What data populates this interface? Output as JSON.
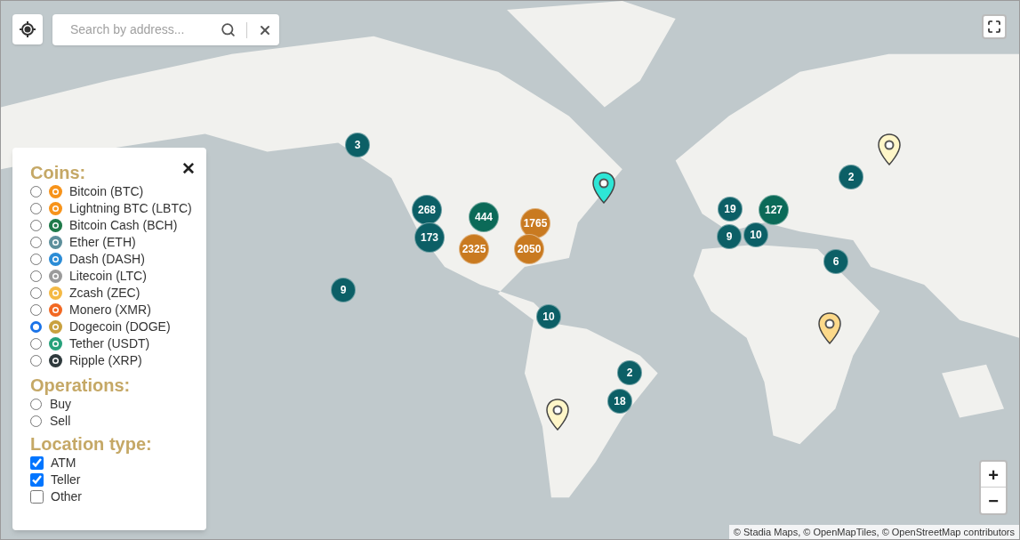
{
  "search": {
    "placeholder": "Search by address..."
  },
  "filters": {
    "close": "✕",
    "coins_title": "Coins:",
    "coins": [
      {
        "label": "Bitcoin (BTC)",
        "selected": false,
        "color": "#f7931a"
      },
      {
        "label": "Lightning BTC (LBTC)",
        "selected": false,
        "color": "#f7931a"
      },
      {
        "label": "Bitcoin Cash (BCH)",
        "selected": false,
        "color": "#1f7a4a"
      },
      {
        "label": "Ether (ETH)",
        "selected": false,
        "color": "#5d8f9b"
      },
      {
        "label": "Dash (DASH)",
        "selected": false,
        "color": "#2b8cd6"
      },
      {
        "label": "Litecoin (LTC)",
        "selected": false,
        "color": "#9b9b9b"
      },
      {
        "label": "Zcash (ZEC)",
        "selected": false,
        "color": "#f4b944"
      },
      {
        "label": "Monero (XMR)",
        "selected": false,
        "color": "#f26822"
      },
      {
        "label": "Dogecoin (DOGE)",
        "selected": true,
        "color": "#c9a13f"
      },
      {
        "label": "Tether (USDT)",
        "selected": false,
        "color": "#26a17b"
      },
      {
        "label": "Ripple (XRP)",
        "selected": false,
        "color": "#2f3a3d"
      }
    ],
    "operations_title": "Operations:",
    "operations": [
      {
        "label": "Buy",
        "selected": false
      },
      {
        "label": "Sell",
        "selected": false
      }
    ],
    "location_title": "Location type:",
    "location_types": [
      {
        "label": "ATM",
        "checked": true
      },
      {
        "label": "Teller",
        "checked": true
      },
      {
        "label": "Other",
        "checked": false
      }
    ]
  },
  "clusters": [
    {
      "count": "3",
      "color": "#0c5f66"
    },
    {
      "count": "268",
      "color": "#0c5f66"
    },
    {
      "count": "173",
      "color": "#0c5f66"
    },
    {
      "count": "444",
      "color": "#0b6a58"
    },
    {
      "count": "2325",
      "color": "#c97a20"
    },
    {
      "count": "1765",
      "color": "#c97a20"
    },
    {
      "count": "2050",
      "color": "#c97a20"
    },
    {
      "count": "9",
      "color": "#0c5f66"
    },
    {
      "count": "10",
      "color": "#0c5f66"
    },
    {
      "count": "2",
      "color": "#0c5f66"
    },
    {
      "count": "18",
      "color": "#0c5f66"
    },
    {
      "count": "19",
      "color": "#0c5f66"
    },
    {
      "count": "127",
      "color": "#0b6a58"
    },
    {
      "count": "9",
      "color": "#0c5f66"
    },
    {
      "count": "10",
      "color": "#0c5f66"
    },
    {
      "count": "2",
      "color": "#0c5f66"
    },
    {
      "count": "6",
      "color": "#0c5f66"
    }
  ],
  "pins": [
    {
      "color": "#2ee6d6"
    },
    {
      "color": "#fff6c8"
    },
    {
      "color": "#fcd98a"
    },
    {
      "color": "#fff6c8"
    }
  ],
  "zoom": {
    "in": "+",
    "out": "−"
  },
  "attribution": "© Stadia Maps, © OpenMapTiles, © OpenStreetMap contributors"
}
